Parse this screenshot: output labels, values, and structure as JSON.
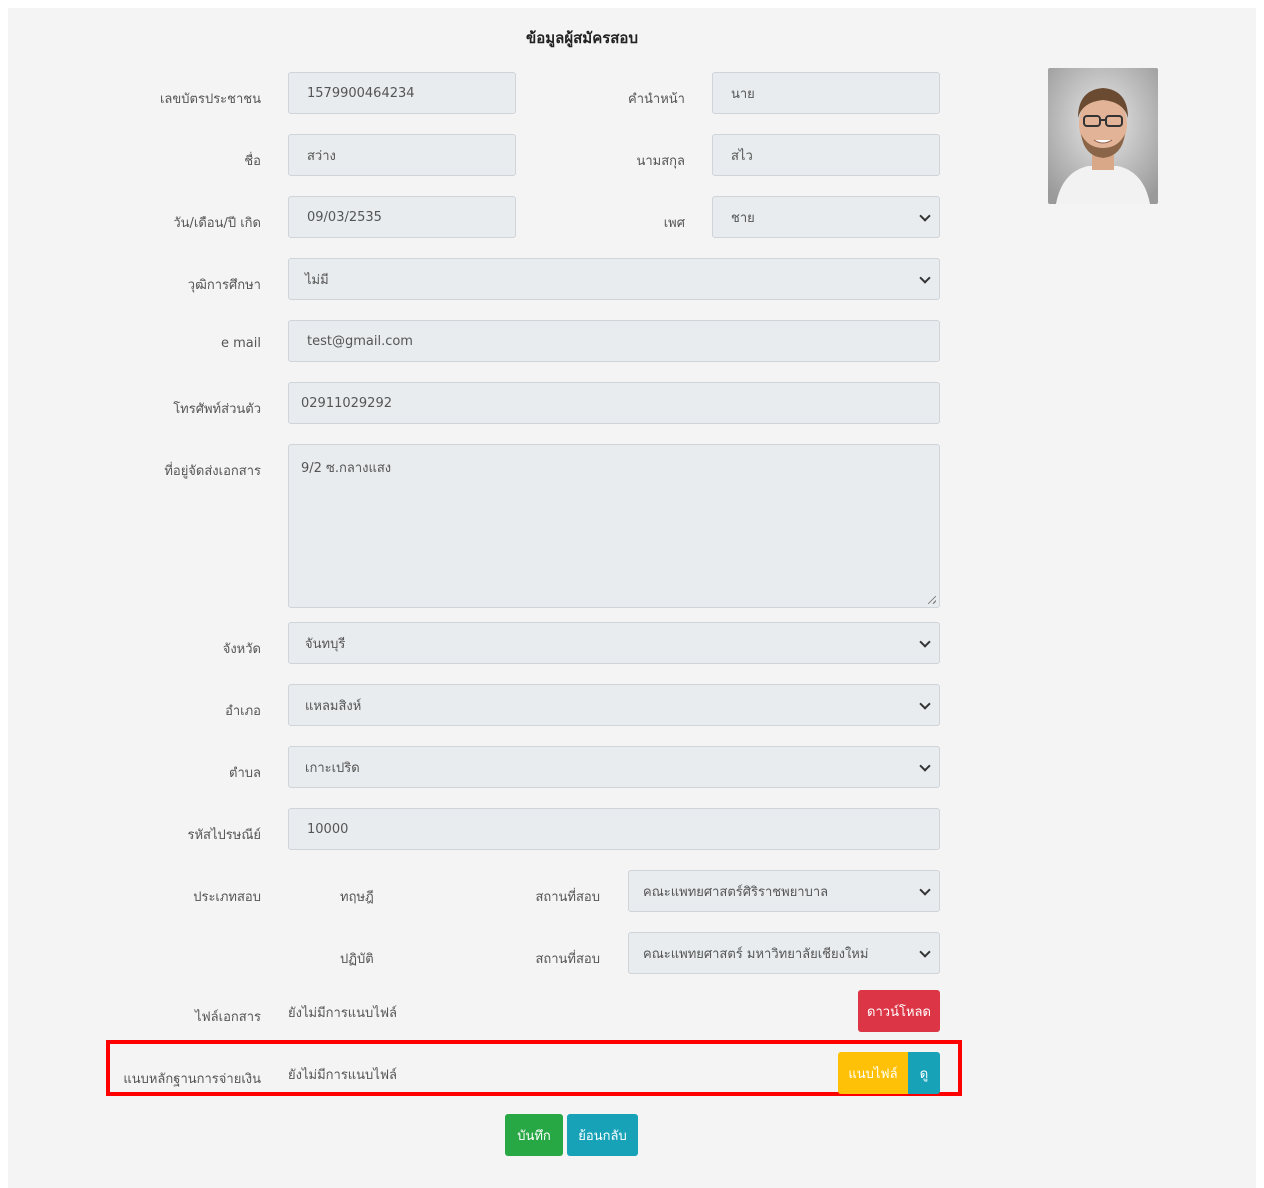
{
  "page": {
    "title": "ข้อมูลผู้สมัครสอบ"
  },
  "form": {
    "id_card": {
      "label": "เลขบัตรประชาชน",
      "value": "1579900464234"
    },
    "prefix": {
      "label": "คำนำหน้า",
      "value": "นาย"
    },
    "first_name": {
      "label": "ชื่อ",
      "value": "สว่าง"
    },
    "last_name": {
      "label": "นามสกุล",
      "value": "สไว"
    },
    "birth_date": {
      "label": "วัน/เดือน/ปี เกิด",
      "value": "09/03/2535"
    },
    "gender": {
      "label": "เพศ",
      "value": "ชาย"
    },
    "education": {
      "label": "วุฒิการศึกษา",
      "value": "ไม่มี"
    },
    "email": {
      "label": "e mail",
      "value": "test@gmail.com"
    },
    "phone": {
      "label": "โทรศัพท์ส่วนตัว",
      "value": "02911029292"
    },
    "address": {
      "label": "ที่อยู่จัดส่งเอกสาร",
      "value": "9/2 ซ.กลางแสง"
    },
    "province": {
      "label": "จังหวัด",
      "value": "จันทบุรี"
    },
    "district": {
      "label": "อำเภอ",
      "value": "แหลมสิงห์"
    },
    "subdistrict": {
      "label": "ตำบล",
      "value": "เกาะเปริด"
    },
    "postcode": {
      "label": "รหัสไปรษณีย์",
      "value": "10000"
    },
    "exam_type": {
      "label": "ประเภทสอบ",
      "theory_label": "ทฤษฎี",
      "practice_label": "ปฏิบัติ",
      "venue_label": "สถานที่สอบ",
      "theory_venue": "คณะแพทยศาสตร์ศิริราชพยาบาล",
      "practice_venue": "คณะแพทยศาสตร์ มหาวิทยาลัยเชียงใหม่"
    },
    "document_file": {
      "label": "ไฟล์เอกสาร",
      "status": "ยังไม่มีการแนบไฟล์",
      "download_label": "ดาวน์โหลด"
    },
    "payment_file": {
      "label": "แนบหลักฐานการจ่ายเงิน",
      "status": "ยังไม่มีการแนบไฟล์",
      "attach_label": "แนบไฟล์",
      "view_label": "ดู"
    }
  },
  "actions": {
    "save_label": "บันทึก",
    "back_label": "ย้อนกลับ"
  },
  "colors": {
    "download": "#dc3545",
    "attach": "#ffc107",
    "view": "#17a2b8",
    "save": "#28a745",
    "back": "#17a2b8",
    "highlight_border": "#ff0000"
  }
}
